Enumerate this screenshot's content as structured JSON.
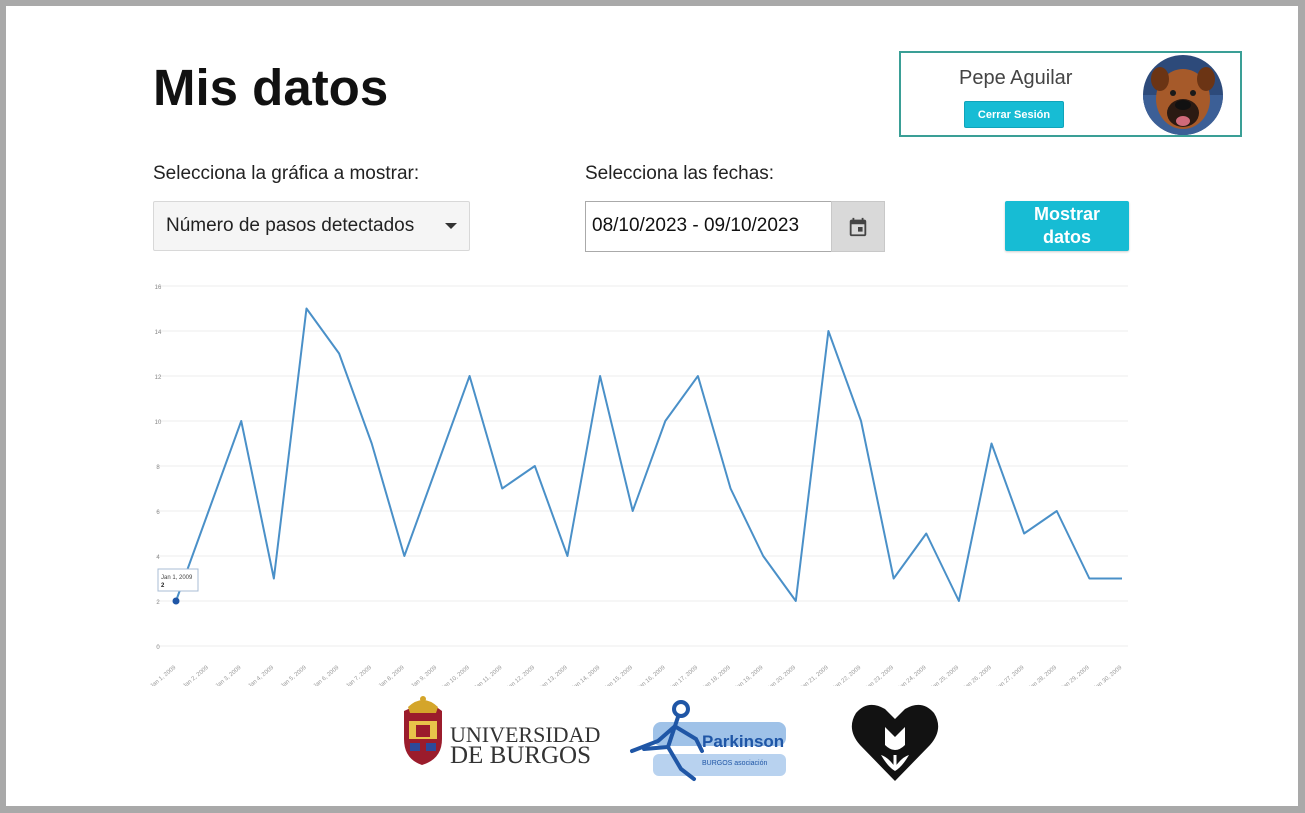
{
  "page": {
    "title": "Mis datos"
  },
  "user": {
    "name": "Pepe Aguilar",
    "logout_label": "Cerrar Sesión"
  },
  "controls": {
    "chart_label": "Selecciona la gráfica a mostrar:",
    "chart_selected": "Número de pasos detectados",
    "dates_label": "Selecciona las fechas:",
    "date_range": "08/10/2023 - 09/10/2023",
    "show_line1": "Mostrar",
    "show_line2": "datos"
  },
  "tooltip": {
    "date": "Jan 1, 2009",
    "value": "2"
  },
  "logos": {
    "ubu_line1": "UNIVERSIDAD",
    "ubu_line2": "DE BURGOS",
    "parkinson_title": "Parkinson",
    "parkinson_sub": "BURGOS asociación"
  },
  "colors": {
    "accent": "#17bcd4",
    "line": "#4a90c8",
    "card_border": "#3a9f96"
  },
  "chart_data": {
    "type": "line",
    "x": [
      "Jan 1, 2009",
      "Jan 2, 2009",
      "Jan 3, 2009",
      "Jan 4, 2009",
      "Jan 5, 2009",
      "Jan 6, 2009",
      "Jan 7, 2009",
      "Jan 8, 2009",
      "Jan 9, 2009",
      "Jan 10, 2009",
      "Jan 11, 2009",
      "Jan 12, 2009",
      "Jan 13, 2009",
      "Jan 14, 2009",
      "Jan 15, 2009",
      "Jan 16, 2009",
      "Jan 17, 2009",
      "Jan 18, 2009",
      "Jan 19, 2009",
      "Jan 20, 2009",
      "Jan 21, 2009",
      "Jan 22, 2009",
      "Jan 23, 2009",
      "Jan 24, 2009",
      "Jan 25, 2009",
      "Jan 26, 2009",
      "Jan 27, 2009",
      "Jan 28, 2009",
      "Jan 29, 2009",
      "Jan 30, 2009",
      "Jan 31, 2009"
    ],
    "series": [
      {
        "values": [
          2,
          6,
          10,
          3,
          15,
          13,
          9,
          4,
          8,
          12,
          7,
          8,
          4,
          12,
          6,
          10,
          12,
          7,
          4,
          2,
          14,
          10,
          3,
          5,
          2,
          9,
          5,
          6,
          3,
          3
        ]
      }
    ],
    "y_ticks": [
      0,
      2,
      4,
      6,
      8,
      10,
      12,
      14,
      16
    ],
    "ylim": [
      0,
      16
    ],
    "grid": true,
    "x_tick_labels": [
      "Jan 1, 2009",
      "Jan 2, 2009",
      "Jan 3, 2009",
      "Jan 4, 2009",
      "Jan 5, 2009",
      "Jan 6, 2009",
      "Jan 7, 2009",
      "Jan 8, 2009",
      "Jan 9, 2009",
      "Jan 10, 2009",
      "Jan 11, 2009",
      "Jan 12, 2009",
      "Jan 13, 2009",
      "Jan 14, 2009",
      "Jan 15, 2009",
      "Jan 16, 2009",
      "Jan 17, 2009",
      "Jan 18, 2009",
      "Jan 19, 2009",
      "Jan 20, 2009",
      "Jan 21, 2009",
      "Jan 22, 2009",
      "Jan 23, 2009",
      "Jan 24, 2009",
      "Jan 25, 2009",
      "Jan 26, 2009",
      "Jan 27, 2009",
      "Jan 28, 2009",
      "Jan 29, 2009",
      "Jan 30, 2009"
    ]
  }
}
